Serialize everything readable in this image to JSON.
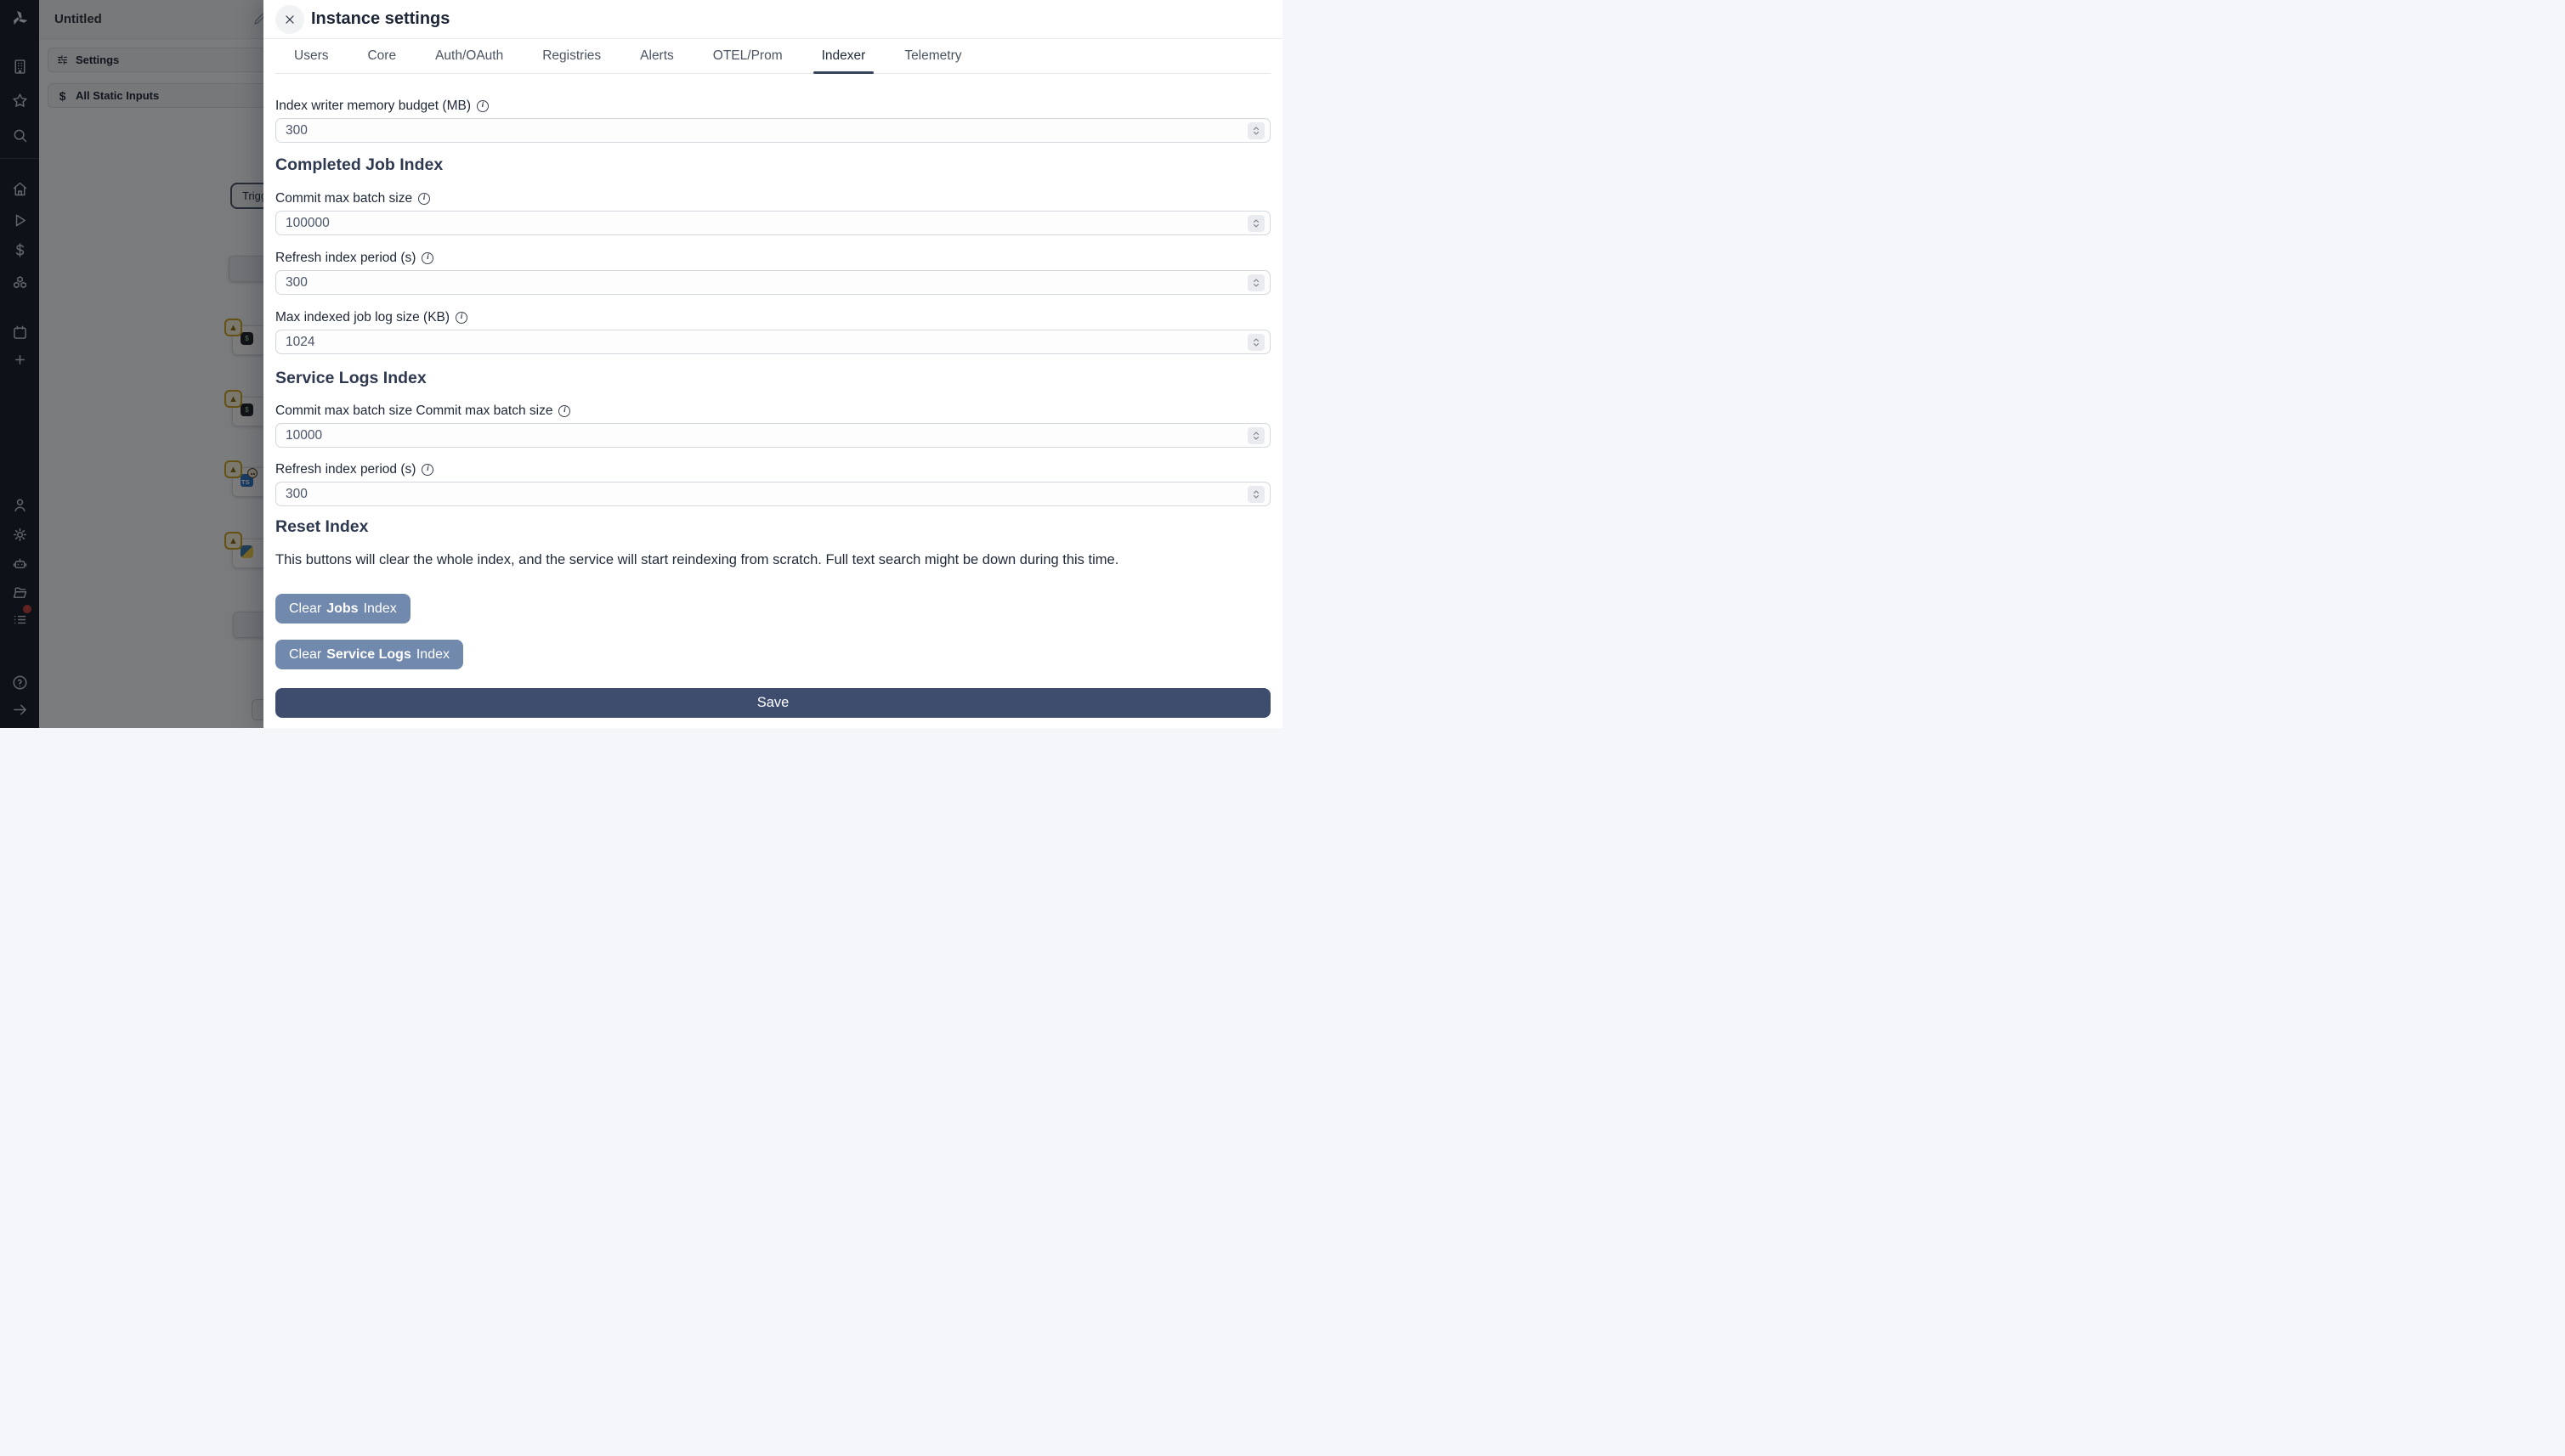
{
  "sidebar": {
    "logo_icon": "windmill-logo",
    "icons": [
      {
        "name": "workspace-icon"
      },
      {
        "name": "favorites-icon"
      },
      {
        "name": "search-icon"
      },
      {
        "name": "home-icon"
      },
      {
        "name": "runs-icon"
      },
      {
        "name": "variables-icon"
      },
      {
        "name": "resources-icon"
      },
      {
        "name": "schedules-icon"
      },
      {
        "name": "add-icon"
      },
      {
        "name": "user-icon"
      },
      {
        "name": "settings-icon"
      },
      {
        "name": "ai-icon",
        "badge": false
      },
      {
        "name": "folders-icon"
      },
      {
        "name": "audit-logs-icon",
        "badge": true
      },
      {
        "name": "help-icon"
      },
      {
        "name": "expand-icon"
      }
    ],
    "badge_color": "#c74444"
  },
  "flow": {
    "title": "Untitled",
    "menu": [
      {
        "label": "Settings"
      },
      {
        "label": "All Static Inputs"
      }
    ],
    "trigger_label": "Trigg",
    "node_icons": [
      "warning-icon",
      "bash-icon",
      "bash-icon",
      "typescript-bun-icon",
      "python-icon"
    ]
  },
  "modal": {
    "title": "Instance settings",
    "tabs": [
      {
        "label": "Users"
      },
      {
        "label": "Core"
      },
      {
        "label": "Auth/OAuth"
      },
      {
        "label": "Registries"
      },
      {
        "label": "Alerts"
      },
      {
        "label": "OTEL/Prom"
      },
      {
        "label": "Indexer"
      },
      {
        "label": "Telemetry"
      }
    ],
    "active_tab": "Indexer",
    "indexer": {
      "top_field": {
        "label": "Index writer memory budget (MB)",
        "value": "300",
        "info": true
      },
      "sections": [
        {
          "heading": "Completed Job Index",
          "fields": [
            {
              "label": "Commit max batch size",
              "value": "100000",
              "info": true
            },
            {
              "label": "Refresh index period (s)",
              "value": "300",
              "info": true
            },
            {
              "label": "Max indexed job log size (KB)",
              "value": "1024",
              "info": true
            }
          ]
        },
        {
          "heading": "Service Logs Index",
          "fields": [
            {
              "label": "Commit max batch size Commit max batch size",
              "value": "10000",
              "info": true
            },
            {
              "label": "Refresh index period (s)",
              "value": "300",
              "info": true
            }
          ]
        },
        {
          "heading": "Reset Index",
          "description": "This buttons will clear the whole index, and the service will start reindexing from scratch. Full text search might be down during this time.",
          "buttons": [
            {
              "prefix": "Clear",
              "emphasis": "Jobs",
              "suffix": "Index"
            },
            {
              "prefix": "Clear",
              "emphasis": "Service Logs",
              "suffix": "Index"
            }
          ]
        }
      ],
      "save_label": "Save"
    },
    "colors": {
      "clear_button": "#7189ad",
      "save_button": "#3e4c6e",
      "tab_underline": "#39455e",
      "warning_badge_border": "#c9a227"
    }
  }
}
